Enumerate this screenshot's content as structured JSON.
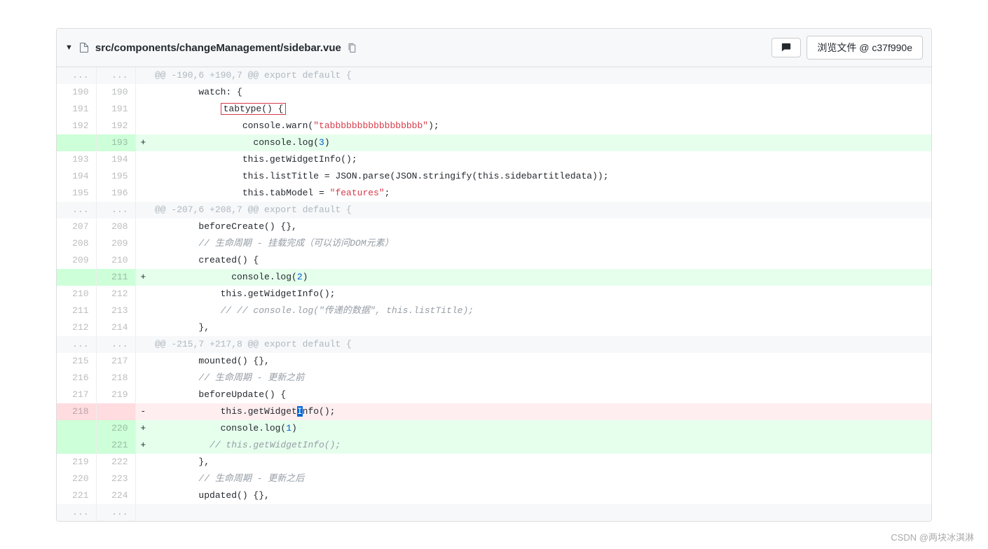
{
  "file_path": "src/components/changeManagement/sidebar.vue",
  "browse_label": "浏览文件 @ c37f990e",
  "watermark": "CSDN @两块冰淇淋",
  "rows": [
    {
      "type": "hunk",
      "old": "...",
      "new": "...",
      "sign": "",
      "html": "@@ -190,6 +190,7 @@ export default {"
    },
    {
      "type": "ctx",
      "old": "190",
      "new": "190",
      "sign": " ",
      "html": "        watch: {"
    },
    {
      "type": "ctx",
      "old": "191",
      "new": "191",
      "sign": " ",
      "html": "            <span class=\"box-outline\">tabtype() {</span>"
    },
    {
      "type": "ctx",
      "old": "192",
      "new": "192",
      "sign": " ",
      "html": "                console.warn(<span class=\"tok-str\">\"tabbbbbbbbbbbbbbbbb\"</span>);"
    },
    {
      "type": "add",
      "old": "",
      "new": "193",
      "sign": "+",
      "html": "                  console.log(<span class=\"tok-num\">3</span>)"
    },
    {
      "type": "ctx",
      "old": "193",
      "new": "194",
      "sign": " ",
      "html": "                this.getWidgetInfo();"
    },
    {
      "type": "ctx",
      "old": "194",
      "new": "195",
      "sign": " ",
      "html": "                this.listTitle = JSON.parse(JSON.stringify(this.sidebartitledata));"
    },
    {
      "type": "ctx",
      "old": "195",
      "new": "196",
      "sign": " ",
      "html": "                this.tabModel = <span class=\"tok-str\">\"features\"</span>;"
    },
    {
      "type": "hunk",
      "old": "...",
      "new": "...",
      "sign": "",
      "html": "@@ -207,6 +208,7 @@ export default {"
    },
    {
      "type": "ctx",
      "old": "207",
      "new": "208",
      "sign": " ",
      "html": "        beforeCreate() {},"
    },
    {
      "type": "ctx",
      "old": "208",
      "new": "209",
      "sign": " ",
      "html": "        <span class=\"tok-com\">// 生命周期 - 挂载完成（可以访问DOM元素）</span>"
    },
    {
      "type": "ctx",
      "old": "209",
      "new": "210",
      "sign": " ",
      "html": "        created() {"
    },
    {
      "type": "add",
      "old": "",
      "new": "211",
      "sign": "+",
      "html": "              console.log(<span class=\"tok-num\">2</span>)"
    },
    {
      "type": "ctx",
      "old": "210",
      "new": "212",
      "sign": " ",
      "html": "            this.getWidgetInfo();"
    },
    {
      "type": "ctx",
      "old": "211",
      "new": "213",
      "sign": " ",
      "html": "            <span class=\"tok-com\">// // console.log(\"传递的数据\", this.listTitle);</span>"
    },
    {
      "type": "ctx",
      "old": "212",
      "new": "214",
      "sign": " ",
      "html": "        },"
    },
    {
      "type": "hunk",
      "old": "...",
      "new": "...",
      "sign": "",
      "html": "@@ -215,7 +217,8 @@ export default {"
    },
    {
      "type": "ctx",
      "old": "215",
      "new": "217",
      "sign": " ",
      "html": "        mounted() {},"
    },
    {
      "type": "ctx",
      "old": "216",
      "new": "218",
      "sign": " ",
      "html": "        <span class=\"tok-com\">// 生命周期 - 更新之前</span>"
    },
    {
      "type": "ctx",
      "old": "217",
      "new": "219",
      "sign": " ",
      "html": "        beforeUpdate() {"
    },
    {
      "type": "del",
      "old": "218",
      "new": "",
      "sign": "-",
      "html": "            this.getWidget<span class=\"sel-char\">I</span>nfo();"
    },
    {
      "type": "add",
      "old": "",
      "new": "220",
      "sign": "+",
      "html": "            console.log(<span class=\"tok-num\">1</span>)"
    },
    {
      "type": "add",
      "old": "",
      "new": "221",
      "sign": "+",
      "html": "          <span class=\"tok-com\">// this.getWidgetInfo();</span>"
    },
    {
      "type": "ctx",
      "old": "219",
      "new": "222",
      "sign": " ",
      "html": "        },"
    },
    {
      "type": "ctx",
      "old": "220",
      "new": "223",
      "sign": " ",
      "html": "        <span class=\"tok-com\">// 生命周期 - 更新之后</span>"
    },
    {
      "type": "ctx",
      "old": "221",
      "new": "224",
      "sign": " ",
      "html": "        updated() {},"
    },
    {
      "type": "hunk",
      "old": "...",
      "new": "...",
      "sign": "",
      "html": ""
    }
  ]
}
